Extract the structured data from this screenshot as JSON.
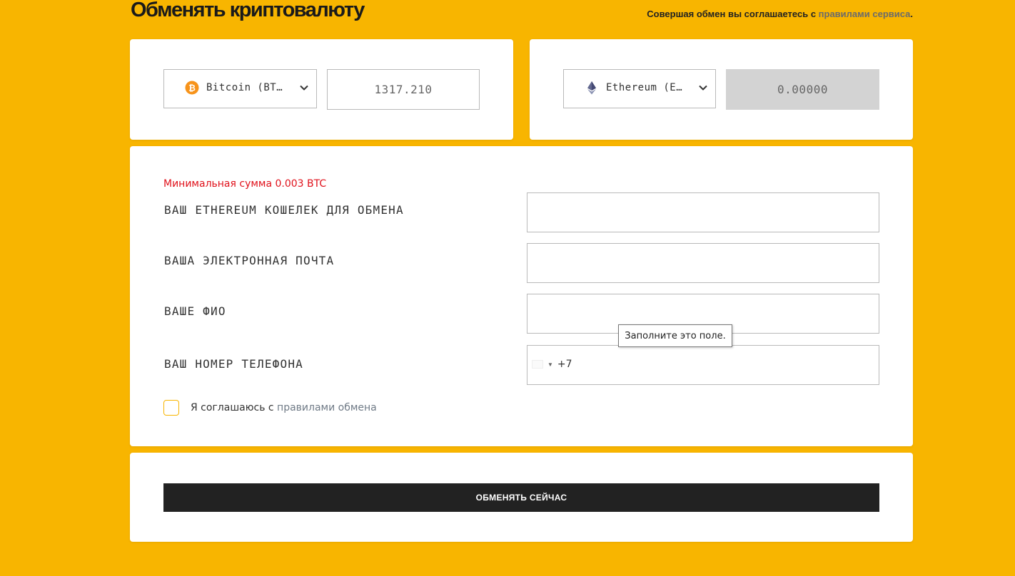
{
  "header": {
    "title": "Обменять криптовалюту",
    "agree_prefix": "Совершая обмен вы соглашаетесь с ",
    "agree_link": "правилами сервиса",
    "agree_suffix": "."
  },
  "from": {
    "currency_label": "Bitcoin (BT…",
    "currency_icon": "bitcoin-icon",
    "amount": "1317.210"
  },
  "to": {
    "currency_label": "Ethereum (E…",
    "currency_icon": "ethereum-icon",
    "amount": "0.00000"
  },
  "form": {
    "min_sum": "Минимальная сумма 0.003 BTC",
    "wallet_label": "ВАШ ETHEREUM КОШЕЛЕК ДЛЯ ОБМЕНА",
    "email_label": "ВАША ЭЛЕКТРОННАЯ ПОЧТА",
    "name_label": "ВАШЕ ФИО",
    "phone_label": "ВАШ НОМЕР ТЕЛЕФОНА",
    "phone_prefix": "+7",
    "tooltip": "Заполните это поле.",
    "agree_prefix": "Я соглашаюсь с ",
    "agree_link": "правилами обмена"
  },
  "submit_label": "ОБМЕНЯТЬ СЕЙЧАС",
  "colors": {
    "background": "#f8b500",
    "error": "#e0111b",
    "button": "#222222",
    "bitcoin": "#f7931a",
    "ethereum": "#62688f"
  }
}
